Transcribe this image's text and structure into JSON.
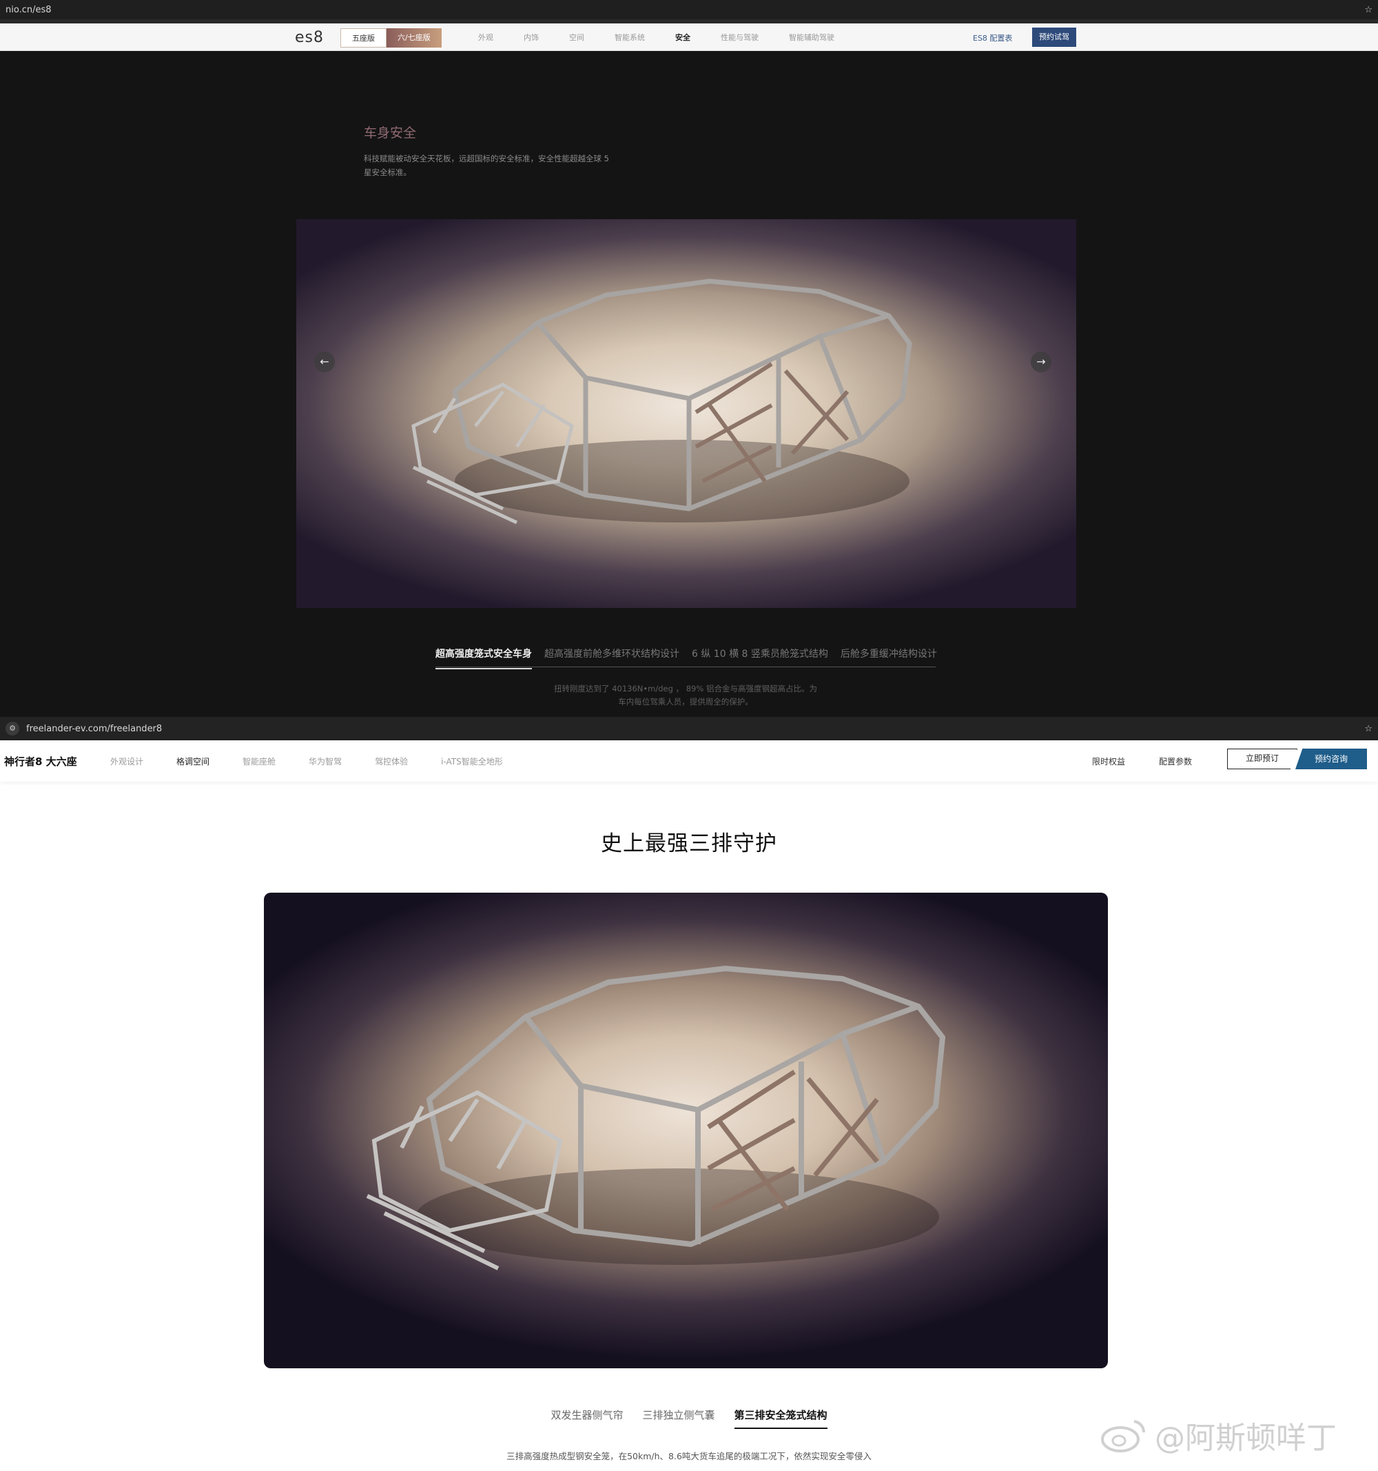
{
  "nio": {
    "browser": {
      "url": "nio.cn/es8",
      "star": "☆"
    },
    "nav": {
      "logo": "es8",
      "seg": [
        "五座版",
        "六/七座版"
      ],
      "links": [
        "外观",
        "内饰",
        "空间",
        "智能系统",
        "安全",
        "性能与驾驶",
        "智能辅助驾驶"
      ],
      "active_link": "安全",
      "spec": "ES8 配置表",
      "cta": "预约试驾"
    },
    "section": {
      "title": "车身安全",
      "desc": "科技赋能被动安全天花板，远超国标的安全标准，安全性能超越全球 5 星安全标准。"
    },
    "carousel": {
      "prev": "←",
      "next": "→"
    },
    "tabs": [
      "超高强度笼式安全车身",
      "超高强度前舱多维环状结构设计",
      "6 纵 10 横 8 竖乘员舱笼式结构",
      "后舱多重缓冲结构设计"
    ],
    "tab_desc": "扭转刚度达到了 40136N•m/deg ， 89% 铝合金与高强度钢超高占比。为车内每位驾乘人员，提供周全的保护。"
  },
  "freelander": {
    "browser": {
      "url": "freelander-ev.com/freelander8",
      "star": "☆"
    },
    "nav": {
      "brand": "神行者8 大六座",
      "links": [
        "外观设计",
        "格调空间",
        "智能座舱",
        "华为智驾",
        "驾控体验",
        "i-ATS智能全地形"
      ],
      "active_link": "格调空间",
      "right1": "限时权益",
      "right2": "配置参数",
      "btn1": "立即预订",
      "btn2": "预约咨询"
    },
    "section": {
      "title": "史上最强三排守护"
    },
    "tabs": [
      "双发生器侧气帘",
      "三排独立侧气囊",
      "第三排安全笼式结构"
    ],
    "active_tab": "第三排安全笼式结构",
    "tab_desc": "三排高强度热成型钢安全笼，在50km/h、8.6吨大货车追尾的极端工况下，依然实现安全零侵入"
  },
  "watermark": "@阿斯顿咩丁",
  "colors": {
    "nio_accent": "#2d4a7a",
    "fl_accent": "#1f5d8a",
    "nio_title": "#8f6a72"
  }
}
